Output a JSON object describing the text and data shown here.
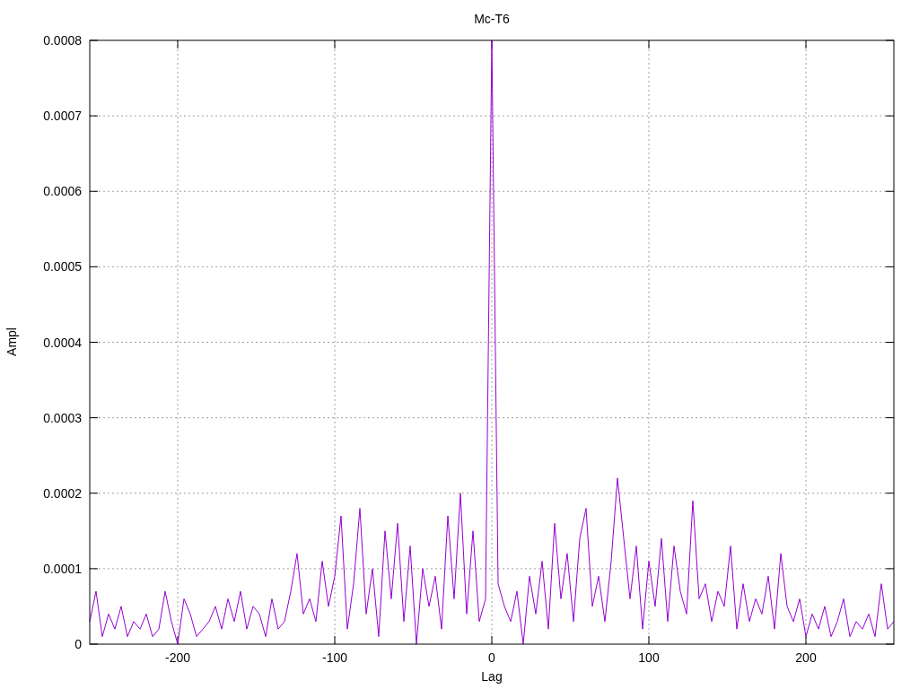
{
  "chart_data": {
    "type": "line",
    "title": "Mc-T6",
    "xlabel": "Lag",
    "grid": true,
    "ylabel": "Ampl",
    "xlim": [
      -256,
      256
    ],
    "ylim": [
      0,
      0.0008
    ],
    "xticks": [
      -200,
      -100,
      0,
      100,
      200
    ],
    "yticks": [
      {
        "value": 0,
        "label": "0"
      },
      {
        "value": 0.0001,
        "label": "0.0001"
      },
      {
        "value": 0.0002,
        "label": "0.0002"
      },
      {
        "value": 0.0003,
        "label": "0.0003"
      },
      {
        "value": 0.0004,
        "label": "0.0004"
      },
      {
        "value": 0.0005,
        "label": "0.0005"
      },
      {
        "value": 0.0006,
        "label": "0.0006"
      },
      {
        "value": 0.0007,
        "label": "0.0007"
      },
      {
        "value": 0.0008,
        "label": "0.0008"
      }
    ],
    "x": [
      -256,
      -252,
      -248,
      -244,
      -240,
      -236,
      -232,
      -228,
      -224,
      -220,
      -216,
      -212,
      -208,
      -204,
      -200,
      -196,
      -192,
      -188,
      -184,
      -180,
      -176,
      -172,
      -168,
      -164,
      -160,
      -156,
      -152,
      -148,
      -144,
      -140,
      -136,
      -132,
      -128,
      -124,
      -120,
      -116,
      -112,
      -108,
      -104,
      -100,
      -96,
      -92,
      -88,
      -84,
      -80,
      -76,
      -72,
      -68,
      -64,
      -60,
      -56,
      -52,
      -48,
      -44,
      -40,
      -36,
      -32,
      -28,
      -24,
      -20,
      -16,
      -12,
      -8,
      -4,
      0,
      4,
      8,
      12,
      16,
      20,
      24,
      28,
      32,
      36,
      40,
      44,
      48,
      52,
      56,
      60,
      64,
      68,
      72,
      76,
      80,
      84,
      88,
      92,
      96,
      100,
      104,
      108,
      112,
      116,
      120,
      124,
      128,
      132,
      136,
      140,
      144,
      148,
      152,
      156,
      160,
      164,
      168,
      172,
      176,
      180,
      184,
      188,
      192,
      196,
      200,
      204,
      208,
      212,
      216,
      220,
      224,
      228,
      232,
      236,
      240,
      244,
      248,
      252,
      256
    ],
    "series": [
      {
        "color": "#9400d3",
        "values": [
          3e-05,
          7e-05,
          1e-05,
          4e-05,
          2e-05,
          5e-05,
          1e-05,
          3e-05,
          2e-05,
          4e-05,
          1e-05,
          2e-05,
          7e-05,
          3e-05,
          0,
          6e-05,
          4e-05,
          1e-05,
          2e-05,
          3e-05,
          5e-05,
          2e-05,
          6e-05,
          3e-05,
          7e-05,
          2e-05,
          5e-05,
          4e-05,
          1e-05,
          6e-05,
          2e-05,
          3e-05,
          7e-05,
          0.00012,
          4e-05,
          6e-05,
          3e-05,
          0.00011,
          5e-05,
          9e-05,
          0.00017,
          2e-05,
          8e-05,
          0.00018,
          4e-05,
          0.0001,
          1e-05,
          0.00015,
          6e-05,
          0.00016,
          3e-05,
          0.00013,
          0,
          0.0001,
          5e-05,
          9e-05,
          2e-05,
          0.00017,
          6e-05,
          0.0002,
          4e-05,
          0.00015,
          3e-05,
          6e-05,
          0.0008,
          8e-05,
          5e-05,
          3e-05,
          7e-05,
          0,
          9e-05,
          4e-05,
          0.00011,
          2e-05,
          0.00016,
          6e-05,
          0.00012,
          3e-05,
          0.00014,
          0.00018,
          5e-05,
          9e-05,
          3e-05,
          0.00011,
          0.00022,
          0.00014,
          6e-05,
          0.00013,
          2e-05,
          0.00011,
          5e-05,
          0.00014,
          3e-05,
          0.00013,
          7e-05,
          4e-05,
          0.00019,
          6e-05,
          8e-05,
          3e-05,
          7e-05,
          5e-05,
          0.00013,
          2e-05,
          8e-05,
          3e-05,
          6e-05,
          4e-05,
          9e-05,
          2e-05,
          0.00012,
          5e-05,
          3e-05,
          6e-05,
          1e-05,
          4e-05,
          2e-05,
          5e-05,
          1e-05,
          3e-05,
          6e-05,
          1e-05,
          3e-05,
          2e-05,
          4e-05,
          1e-05,
          8e-05,
          2e-05,
          3e-05
        ]
      }
    ]
  }
}
